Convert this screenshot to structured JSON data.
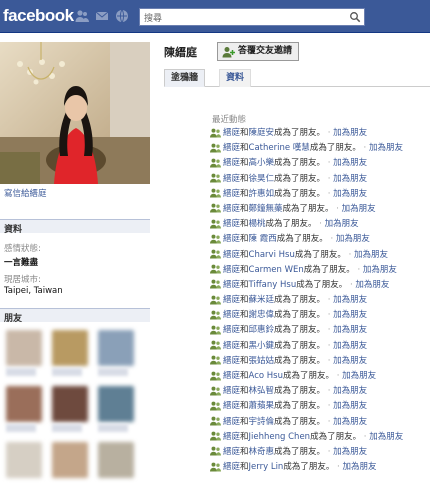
{
  "topbar": {
    "logo": "facebook",
    "search_value": "搜尋",
    "icons": [
      "friend-requests-icon",
      "messages-icon",
      "notifications-icon",
      "search-icon"
    ]
  },
  "profile": {
    "name": "陳縉庭",
    "invite_button": "答覆交友邀請",
    "write_link": "寫信給縉庭",
    "tabs": [
      "塗鴉牆",
      "資料"
    ]
  },
  "info": {
    "heading": "資料",
    "relationship_label": "感情狀態:",
    "relationship_value": "一言難盡",
    "hometown_label": "現居城市:",
    "hometown_value": "Taipei, Taiwan"
  },
  "friends": {
    "heading": "朋友"
  },
  "feed": {
    "heading": "最近動態",
    "actor": "縉庭",
    "connector": "和",
    "suffix": "成為了朋友。",
    "separator": "·",
    "add_friend": "加為朋友",
    "items": [
      "陳庭安",
      "Catherine 嘆慧",
      "高小樂",
      "徐昊仁",
      "許惠如",
      "鄭鐘無藥",
      "楊桃",
      "陳 霞西",
      "Charvi Hsu",
      "Carmen WEn",
      "Tiffany Hsu",
      "蘇米廷",
      "謝忠偉",
      "邱惠鈴",
      "黑小鍵",
      "張姑姑",
      "Aco Hsu",
      "林弘智",
      "蕭蘋果",
      "宇詩倫",
      "Jiehheng Chen",
      "林奇惠",
      "Jerry Lin"
    ]
  },
  "colors": {
    "brand": "#3b5998",
    "link": "#3b5998",
    "section_bg": "#eceff5"
  }
}
